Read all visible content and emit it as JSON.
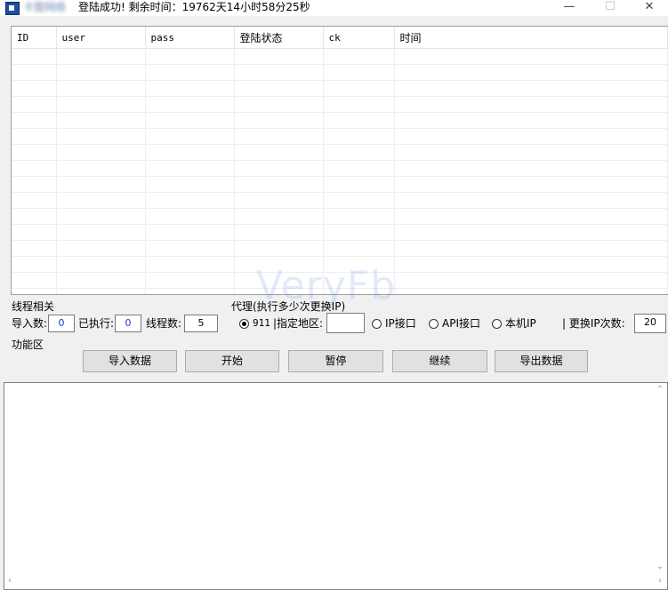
{
  "window": {
    "app_name": "卡盟网络",
    "title_text": "登陆成功! 剩余时间：19762天14小时58分25秒",
    "minimize_glyph": "—",
    "maximize_glyph": "☐",
    "close_glyph": "✕"
  },
  "grid": {
    "columns": [
      "ID",
      "user",
      "pass",
      "登陆状态",
      "ck",
      "时间"
    ],
    "empty_rows": 18
  },
  "threads": {
    "section_label": "线程相关",
    "import_label": "导入数:",
    "import_value": "0",
    "executed_label": "已执行:",
    "executed_value": "0",
    "thread_count_label": "线程数:",
    "thread_count_value": "5"
  },
  "proxy": {
    "section_label": "代理(执行多少次更换IP)",
    "option_911": "911",
    "region_label": "|指定地区:",
    "region_value": "",
    "option_ip_api": "IP接口",
    "option_api": "API接口",
    "option_local": "本机IP",
    "switch_label": "| 更换IP次数:",
    "switch_value": "20"
  },
  "functions": {
    "section_label": "功能区",
    "import_button": "导入数据",
    "start_button": "开始",
    "pause_button": "暂停",
    "continue_button": "继续",
    "export_button": "导出数据"
  },
  "log": {
    "text": ""
  },
  "watermark": "VeryFb"
}
